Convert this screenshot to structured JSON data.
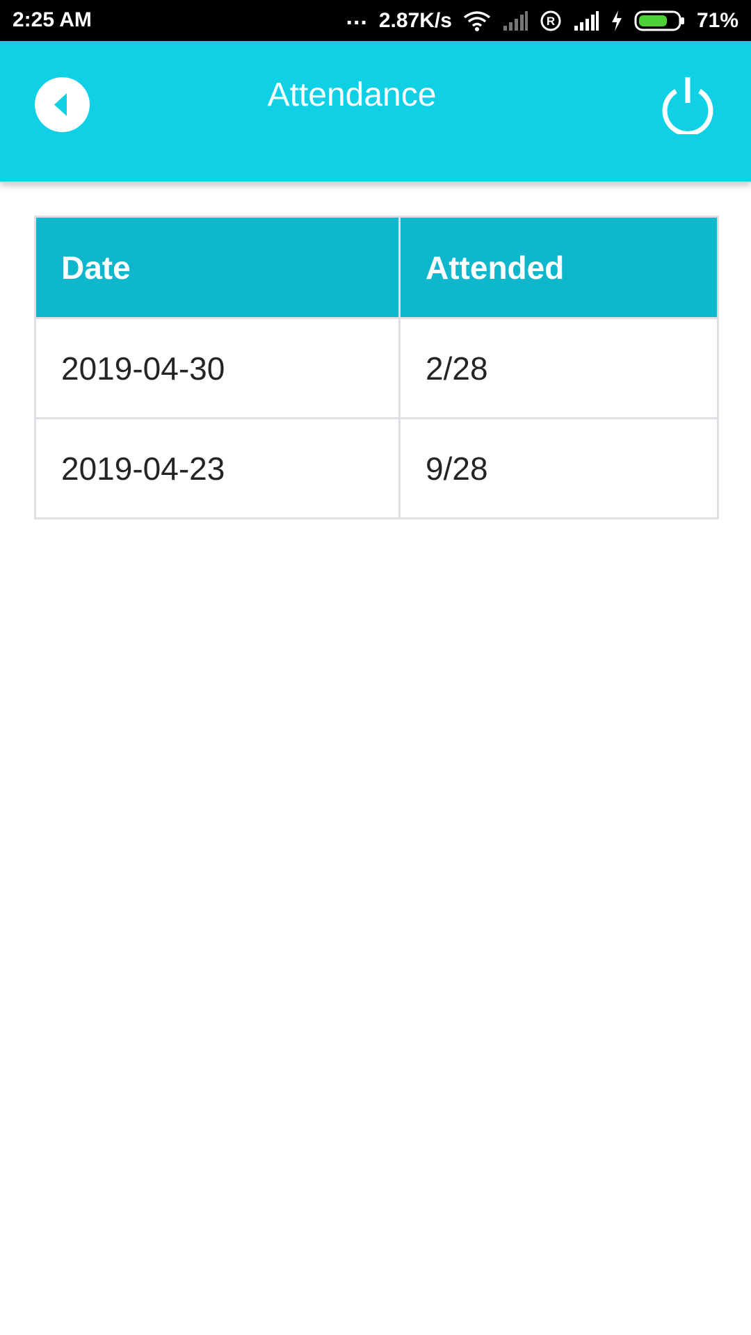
{
  "status_bar": {
    "time": "2:25 AM",
    "dots": "...",
    "network_speed": "2.87K/s",
    "battery_percent": "71%",
    "battery_level": 0.71,
    "battery_color": "#4cd137",
    "icons": [
      "wifi-icon",
      "signal-weak-icon",
      "registered-icon",
      "signal-icon",
      "charging-icon",
      "battery-icon"
    ]
  },
  "app_bar": {
    "title": "Attendance",
    "background_color": "#10d0e6",
    "back_icon": "chevron-left-icon",
    "power_icon": "power-icon"
  },
  "table": {
    "header_color": "#0fb7cc",
    "columns": [
      "Date",
      "Attended"
    ],
    "rows": [
      [
        "2019-04-30",
        "2/28"
      ],
      [
        "2019-04-23",
        "9/28"
      ]
    ]
  }
}
